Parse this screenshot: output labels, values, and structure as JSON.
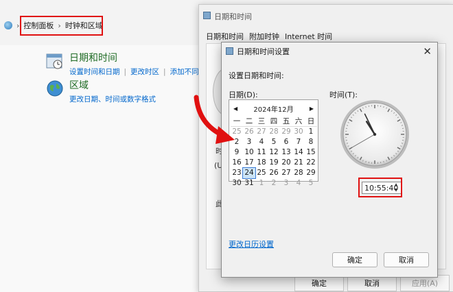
{
  "control_panel": {
    "breadcrumb": [
      "控制面板",
      "时钟和区域"
    ],
    "categories": [
      {
        "title": "日期和时间",
        "links": [
          "设置时间和日期",
          "更改时区",
          "添加不同时"
        ]
      },
      {
        "title": "区域",
        "links": [
          "更改日期、时间或数字格式"
        ]
      }
    ]
  },
  "back_dialog": {
    "title": "日期和时间",
    "tabs": [
      "日期和时间",
      "附加时钟",
      "Internet 时间"
    ],
    "fragments": [
      "时",
      "(U",
      "此"
    ],
    "buttons": {
      "ok": "确定",
      "cancel": "取消",
      "apply": "应用(A)"
    }
  },
  "dialog": {
    "title": "日期和时间设置",
    "prompt": "设置日期和时间:",
    "date_label": "日期(D):",
    "time_label": "时间(T):",
    "calendar": {
      "month_label": "2024年12月",
      "weekdays": [
        "一",
        "二",
        "三",
        "四",
        "五",
        "六",
        "日"
      ],
      "days": [
        "25",
        "26",
        "27",
        "28",
        "29",
        "30",
        "1",
        "2",
        "3",
        "4",
        "5",
        "6",
        "7",
        "8",
        "9",
        "10",
        "11",
        "12",
        "13",
        "14",
        "15",
        "16",
        "17",
        "18",
        "19",
        "20",
        "21",
        "22",
        "23",
        "24",
        "25",
        "26",
        "27",
        "28",
        "29",
        "30",
        "31",
        "1",
        "2",
        "3",
        "4",
        "5"
      ],
      "selected_day": "24"
    },
    "time_value": "10:55:40",
    "clock": {
      "hour": 10,
      "minute": 55,
      "second": 40
    },
    "change_calendar_link": "更改日历设置",
    "ok": "确定",
    "cancel": "取消"
  },
  "colors": {
    "highlight": "#e01010",
    "link": "#0066cc",
    "category": "#1e6b24"
  }
}
